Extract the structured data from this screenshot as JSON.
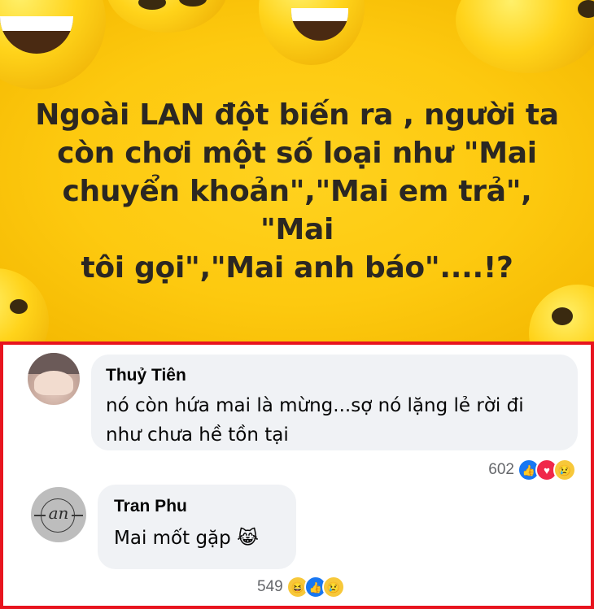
{
  "meme": {
    "lines": [
      "Ngoài LAN đột biến ra , người ta",
      "còn chơi một số loại như \"Mai",
      "chuyển khoản\",\"Mai em trả\", \"Mai",
      "tôi gọi\",\"Mai anh báo\"....!?"
    ],
    "background_color": "#fdc90f",
    "highlight_color": "#e8141e"
  },
  "comments": [
    {
      "author": "Thuỷ Tiên",
      "lines": [
        "nó còn hứa mai là mừng...sợ nó lặng lẻ rời đi",
        "như chưa hề tồn tại"
      ],
      "reaction_count": "602",
      "reactions": [
        "like-icon",
        "love-icon",
        "sad-icon"
      ]
    },
    {
      "author": "Tran Phu",
      "text": "Mai mốt gặp",
      "emoji": "😹",
      "avatar_monogram": "an",
      "reaction_count": "549",
      "reactions": [
        "haha-icon",
        "like-icon",
        "sad-icon"
      ]
    }
  ]
}
